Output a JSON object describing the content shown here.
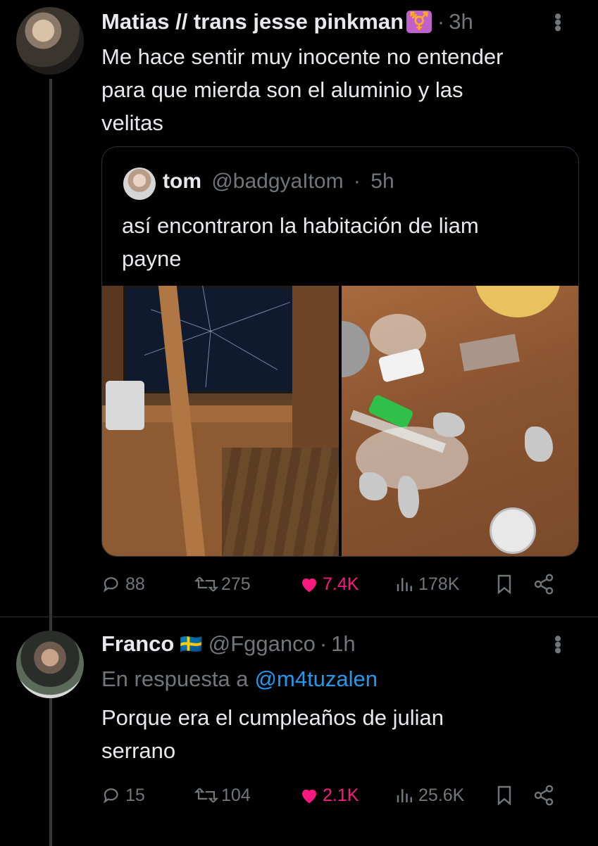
{
  "tweet1": {
    "author_name": "Matias // trans jesse pinkman",
    "author_badge": "⚧️",
    "separator": "·",
    "time": "3h",
    "text_lines": [
      "Me hace sentir muy inocente no entender",
      "para que mierda son el aluminio y las",
      "velitas"
    ],
    "quote": {
      "author_name": "tom",
      "handle": "@badgyaItom",
      "separator": "·",
      "time": "5h",
      "text_lines": [
        "así encontraron la habitación de liam",
        "payne"
      ]
    },
    "actions": {
      "replies": "88",
      "retweets": "275",
      "likes": "7.4K",
      "views": "178K"
    }
  },
  "tweet2": {
    "author_name": "Franco",
    "author_flag": "🇸🇪",
    "handle": "@Fgganco",
    "separator": "·",
    "time": "1h",
    "reply_prefix": "En respuesta a",
    "reply_to": "@m4tuzalen",
    "text_lines": [
      "Porque era el cumpleaños de julian",
      "serrano"
    ],
    "actions": {
      "replies": "15",
      "retweets": "104",
      "likes": "2.1K",
      "views": "25.6K"
    }
  },
  "colors": {
    "background": "#000000",
    "text": "#e7e9ea",
    "muted": "#71767b",
    "link": "#1d9bf0",
    "like": "#f91880",
    "badge": "#c061cb"
  },
  "icons": [
    "reply-icon",
    "retweet-icon",
    "like-icon",
    "views-icon",
    "bookmark-icon",
    "share-icon",
    "more-icon"
  ]
}
